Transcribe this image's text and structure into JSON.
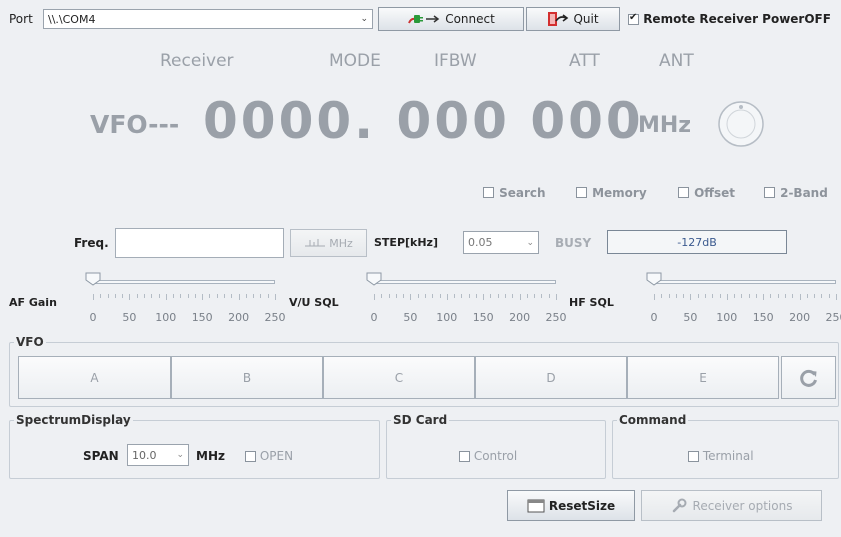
{
  "topbar": {
    "port_label": "Port",
    "port_value": "\\\\.\\COM4",
    "connect_label": "Connect",
    "quit_label": "Quit",
    "remote_power_label": "Remote Receiver PowerOFF",
    "remote_power_checked": true
  },
  "headers": {
    "receiver": "Receiver",
    "mode": "MODE",
    "ifbw": "IFBW",
    "att": "ATT",
    "ant": "ANT"
  },
  "frequency": {
    "vfo_label": "VFO---",
    "display": "0000. 000 000",
    "unit": "MHz"
  },
  "options": {
    "search": "Search",
    "memory": "Memory",
    "offset": "Offset",
    "two_band": "2-Band"
  },
  "freq_row": {
    "freq_label": "Freq.",
    "freq_value": "",
    "mhz_button": "MHz",
    "step_label": "STEP[kHz]",
    "step_value": "0.05",
    "busy_label": "BUSY",
    "signal_value": "-127dB"
  },
  "sliders": {
    "af_gain_label": "AF Gain",
    "vu_sql_label": "V/U SQL",
    "hf_sql_label": "HF SQL",
    "scale": [
      "0",
      "50",
      "100",
      "150",
      "200",
      "250"
    ],
    "af_gain_value": 0,
    "vu_sql_value": 0,
    "hf_sql_value": 0
  },
  "vfo_group": {
    "legend": "VFO",
    "buttons": [
      "A",
      "B",
      "C",
      "D",
      "E"
    ],
    "refresh_icon": "refresh-icon"
  },
  "spectrum": {
    "legend": "SpectrumDisplay",
    "span_label": "SPAN",
    "span_value": "10.0",
    "span_unit": "MHz",
    "open_label": "OPEN"
  },
  "sdcard": {
    "legend": "SD Card",
    "control_label": "Control"
  },
  "command": {
    "legend": "Command",
    "terminal_label": "Terminal"
  },
  "bottom": {
    "reset_size_label": "ResetSize",
    "receiver_options_label": "Receiver options"
  }
}
